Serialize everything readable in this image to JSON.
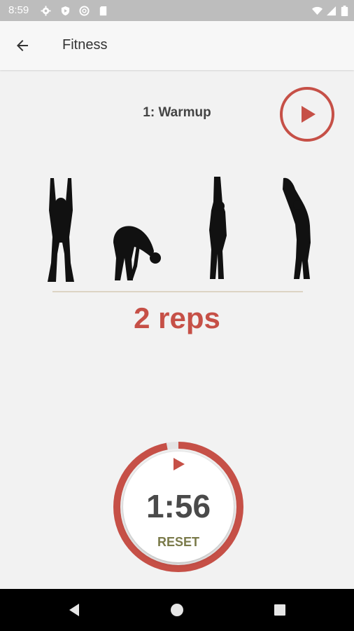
{
  "status_bar": {
    "time": "8:59",
    "left_icons": [
      "gear-icon",
      "shield-icon",
      "at-sign-icon",
      "sd-card-icon"
    ],
    "right_icons": [
      "wifi-icon",
      "cellular-icon",
      "battery-icon"
    ]
  },
  "app_bar": {
    "title": "Fitness",
    "back_icon": "arrow-left-icon"
  },
  "exercise": {
    "title": "1: Warmup",
    "reps": "2 reps",
    "figures": [
      "arms-raised-front-figure",
      "forward-bend-figure",
      "arms-raised-side-figure",
      "back-bend-side-figure"
    ]
  },
  "timer": {
    "value": "1:56",
    "reset_label": "RESET",
    "progress": 0.97
  },
  "colors": {
    "accent": "#c65047",
    "reset": "#7a7a4a",
    "background": "#f2f2f2",
    "status_bar": "#bdbdbd",
    "nav_bar": "#000000"
  },
  "nav_bar": {
    "buttons": [
      "back-triangle-icon",
      "home-circle-icon",
      "recents-square-icon"
    ]
  }
}
